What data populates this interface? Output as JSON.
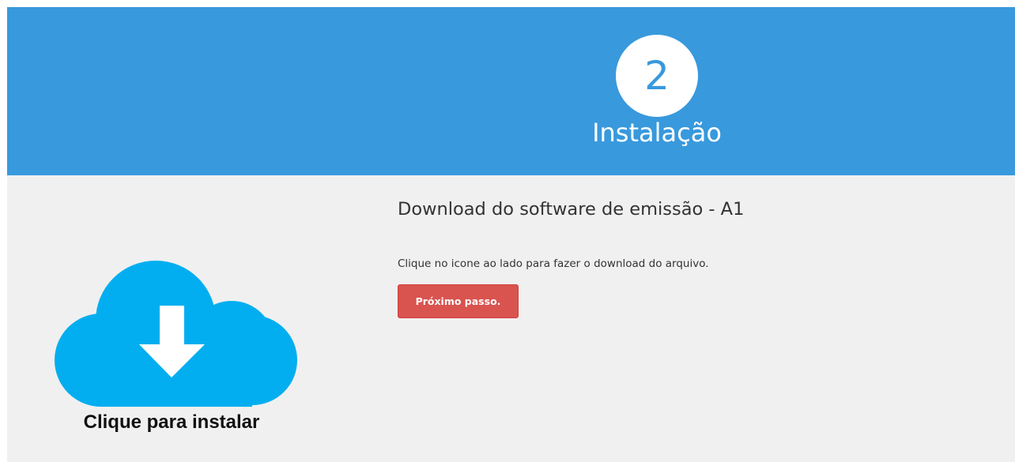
{
  "header": {
    "step_number": "2",
    "step_title": "Instalação"
  },
  "install": {
    "icon": "cloud-download-icon",
    "label": "Clique para instalar",
    "icon_color": "#03aef0"
  },
  "main": {
    "title": "Download do software de emissão - A1",
    "instruction": "Clique no icone ao lado para fazer o download do arquivo.",
    "next_button_label": "Próximo passo."
  },
  "colors": {
    "header_bg": "#3899dd",
    "content_bg": "#f0f0f0",
    "button_bg": "#d9534f"
  }
}
